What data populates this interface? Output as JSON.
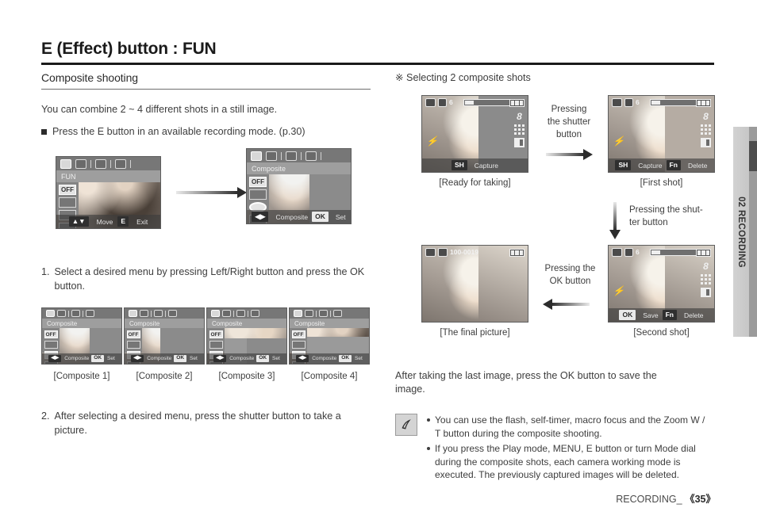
{
  "header": {
    "title": "E (Effect) button : FUN"
  },
  "left": {
    "subhead": "Composite shooting",
    "intro": "You can combine 2 ~ 4 different shots in a still image.",
    "bullet": "Press the E button in an available recording mode. (p.30)",
    "step1": {
      "num": "1.",
      "text": "Select a desired menu by pressing Left/Right button and press the OK button."
    },
    "step2": {
      "num": "2.",
      "text": "After selecting a desired menu, press the shutter button to take a picture."
    },
    "screen_fun": {
      "menu_title": "FUN",
      "left_items": [
        "OFF",
        "",
        "",
        ""
      ],
      "key1": "E",
      "key1_label": "Exit",
      "move_label": "Move"
    },
    "screen_composite": {
      "menu_title": "Composite",
      "left_items": [
        "OFF",
        "",
        "",
        ""
      ],
      "nav_label": "Composite",
      "key_ok": "OK",
      "key_ok_label": "Set"
    },
    "thumbs": [
      {
        "menu_title": "Composite",
        "caption": "[Composite 1]",
        "nav_label": "Composite",
        "key_ok": "OK",
        "key_ok_label": "Set"
      },
      {
        "menu_title": "Composite",
        "caption": "[Composite 2]",
        "nav_label": "Composite",
        "key_ok": "OK",
        "key_ok_label": "Set"
      },
      {
        "menu_title": "Composite",
        "caption": "[Composite 3]",
        "nav_label": "Composite",
        "key_ok": "OK",
        "key_ok_label": "Set"
      },
      {
        "menu_title": "Composite",
        "caption": "[Composite 4]",
        "nav_label": "Composite",
        "key_ok": "OK",
        "key_ok_label": "Set"
      }
    ]
  },
  "right": {
    "subhead": "※ Selecting 2 composite shots",
    "shot_ready": {
      "caption": "[Ready for taking]",
      "counter": "6",
      "resolution": "8",
      "key_sh": "SH",
      "key_sh_label": "Capture"
    },
    "shot_first": {
      "caption": "[First shot]",
      "counter": "6",
      "resolution": "8",
      "key_sh": "SH",
      "key_sh_label": "Capture",
      "key_fn": "Fn",
      "key_fn_label": "Delete"
    },
    "shot_second": {
      "caption": "[Second shot]",
      "counter": "6",
      "resolution": "8",
      "key_ok": "OK",
      "key_ok_label": "Save",
      "key_fn": "Fn",
      "key_fn_label": "Delete"
    },
    "shot_final": {
      "caption": "[The final picture]",
      "file_number": "100-0019"
    },
    "arrow_shutter": "Pressing\nthe shutter\nbutton",
    "arrow_shutter_l1": "Pressing",
    "arrow_shutter_l2": "the shutter",
    "arrow_shutter_l3": "button",
    "arrow_shutter_down_l1": "Pressing the shut-",
    "arrow_shutter_down_l2": "ter button",
    "arrow_ok_l1": "Pressing the",
    "arrow_ok_l2": "OK button",
    "after_text": "After taking the last image, press the OK button to save the image.",
    "notes": [
      "You can use the flash, self-timer, macro focus and the Zoom W / T button during the composite shooting.",
      "If you press the Play mode, MENU, E button or turn Mode dial during the composite shots, each camera working mode is executed. The previously captured images will be deleted."
    ]
  },
  "side_tab": {
    "label": "02 RECORDING"
  },
  "footer": {
    "section": "RECORDING_",
    "page": "《35》"
  }
}
